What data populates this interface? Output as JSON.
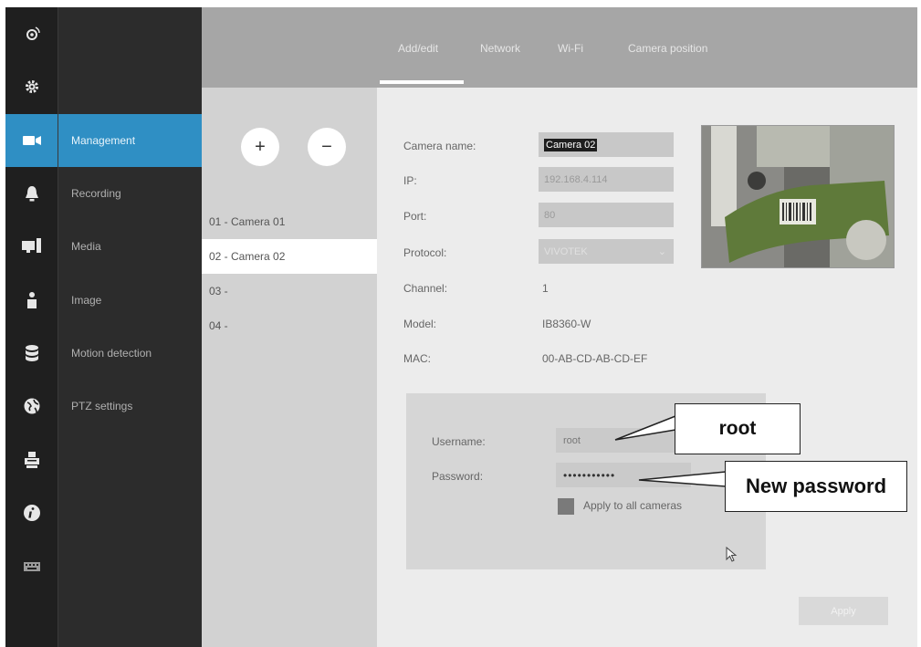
{
  "sidebar": {
    "icons": [
      {
        "icon": "camera-eye-icon",
        "active": false
      },
      {
        "icon": "gear-icon",
        "active": false
      },
      {
        "icon": "video-camera-icon",
        "active": true
      },
      {
        "icon": "bell-icon",
        "active": false
      },
      {
        "icon": "monitor-icon",
        "active": false
      },
      {
        "icon": "user-icon",
        "active": false
      },
      {
        "icon": "database-icon",
        "active": false
      },
      {
        "icon": "globe-icon",
        "active": false
      },
      {
        "icon": "printer-icon",
        "active": false
      },
      {
        "icon": "info-icon",
        "active": false
      },
      {
        "icon": "keyboard-icon",
        "active": false
      }
    ],
    "items": [
      {
        "label": "Management",
        "active": true
      },
      {
        "label": "Recording"
      },
      {
        "label": "Media"
      },
      {
        "label": "Image"
      },
      {
        "label": "Motion detection"
      },
      {
        "label": "PTZ settings"
      }
    ]
  },
  "tabs": [
    {
      "label": "Add/edit",
      "active": true
    },
    {
      "label": "Network"
    },
    {
      "label": "Wi-Fi"
    },
    {
      "label": "Camera position"
    }
  ],
  "camera_list": {
    "add_label": "+",
    "remove_label": "−",
    "items": [
      {
        "label": "01 - Camera 01"
      },
      {
        "label": "02 - Camera 02",
        "selected": true
      },
      {
        "label": "03 -"
      },
      {
        "label": "04 -"
      }
    ]
  },
  "form": {
    "camera_name_label": "Camera name:",
    "camera_name_value": "Camera 02",
    "ip_label": "IP:",
    "ip_value": "192.168.4.114",
    "port_label": "Port:",
    "port_value": "80",
    "protocol_label": "Protocol:",
    "protocol_value": "VIVOTEK",
    "channel_label": "Channel:",
    "channel_value": "1",
    "model_label": "Model:",
    "model_value": "IB8360-W",
    "mac_label": "MAC:",
    "mac_value": "00-AB-CD-AB-CD-EF"
  },
  "credentials": {
    "username_label": "Username:",
    "username_value": "root",
    "password_label": "Password:",
    "password_value": "•••••••••••",
    "apply_all_label": "Apply to all cameras"
  },
  "apply_button": "Apply",
  "callouts": {
    "root": "root",
    "new_password": "New password"
  },
  "colors": {
    "accent": "#2f8fc4",
    "rail": "#1f1f1f",
    "submenu": "#2c2c2c",
    "topbar": "#a6a6a6"
  }
}
